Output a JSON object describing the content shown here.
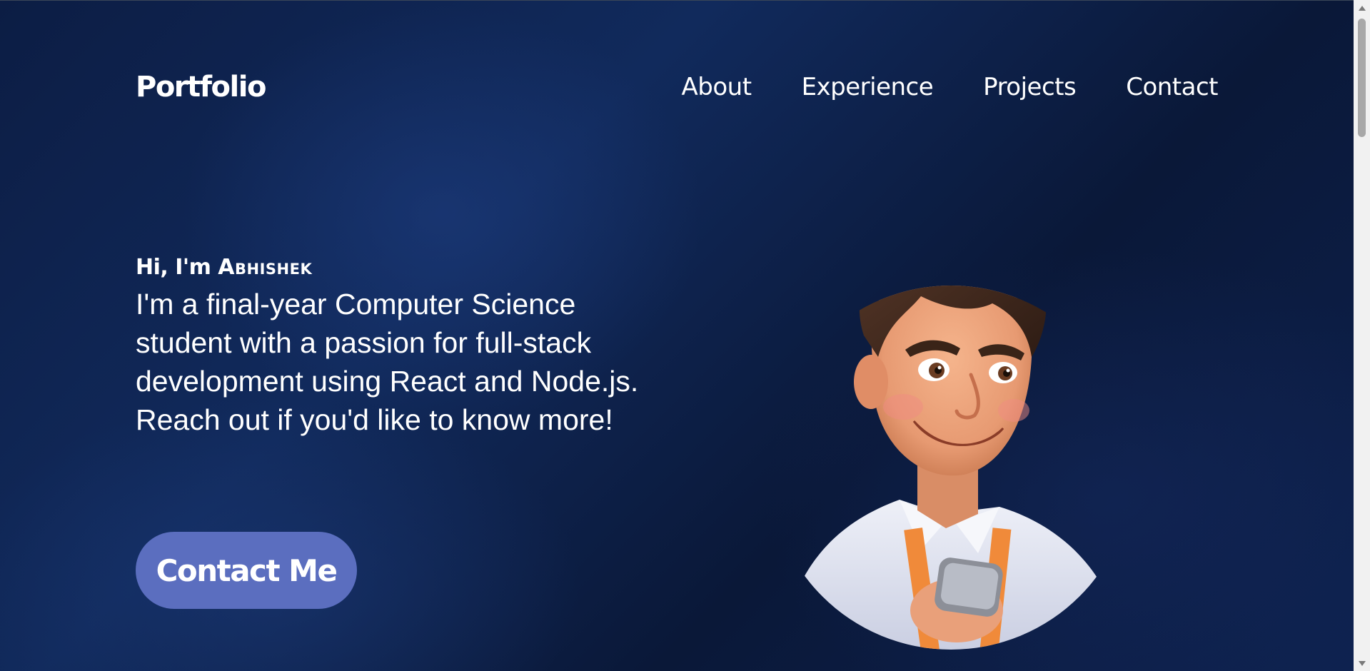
{
  "navbar": {
    "brand": "Portfolio",
    "links": [
      {
        "label": "About"
      },
      {
        "label": "Experience"
      },
      {
        "label": "Projects"
      },
      {
        "label": "Contact"
      }
    ]
  },
  "hero": {
    "greeting_prefix": "Hi, I'm ",
    "greeting_name": "Abhishek",
    "bio": "I'm a final-year Computer Science student with a passion for full-stack development using React and Node.js. Reach out if you'd like to know more!",
    "cta_label": "Contact Me",
    "avatar": "cartoon-developer-avatar"
  },
  "colors": {
    "background": "#0c1d44",
    "cta_button": "#5b6ebf",
    "text": "#ffffff"
  },
  "icons": {
    "scroll_up": "triangle-up-icon",
    "scroll_down": "triangle-down-icon"
  }
}
